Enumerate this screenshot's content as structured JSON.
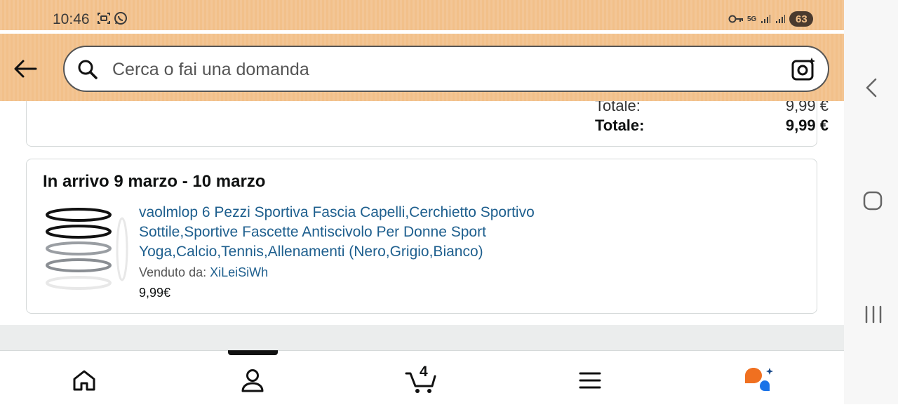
{
  "status_bar": {
    "time": "10:46",
    "network": "5G",
    "battery": "63"
  },
  "search": {
    "placeholder": "Cerca o fai una domanda"
  },
  "summary": {
    "label_partial": "Totale:",
    "value_partial": "9,99 €",
    "label_total": "Totale:",
    "value_total": "9,99 €"
  },
  "order": {
    "delivery": "In arrivo 9 marzo - 10 marzo",
    "product_title": "vaolmlop 6 Pezzi Sportiva Fascia Capelli,Cerchietto Sportivo Sottile,Sportive Fascette Antiscivolo Per Donne Sport Yoga,Calcio,Tennis,Allenamenti (Nero,Grigio,Bianco)",
    "seller_label": "Venduto da:",
    "seller_name": "XiLeiSiWh",
    "price": "9,99€"
  },
  "bottom_nav": {
    "cart_count": "4"
  },
  "colors": {
    "header": "#f2c08a",
    "link": "#1e5f8e",
    "ai_orange": "#f07020",
    "ai_blue": "#1a73e8"
  }
}
